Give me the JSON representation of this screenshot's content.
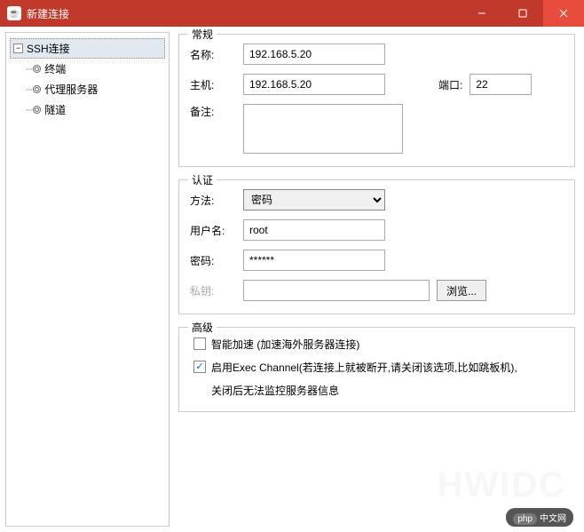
{
  "titlebar": {
    "title": "新建连接"
  },
  "sidebar": {
    "root": {
      "label": "SSH连接",
      "expanded": true
    },
    "children": [
      {
        "label": "终端"
      },
      {
        "label": "代理服务器"
      },
      {
        "label": "隧道"
      }
    ]
  },
  "general": {
    "legend": "常规",
    "name_label": "名称:",
    "name_value": "192.168.5.20",
    "host_label": "主机:",
    "host_value": "192.168.5.20",
    "port_label": "端口:",
    "port_value": "22",
    "remark_label": "备注:",
    "remark_value": ""
  },
  "auth": {
    "legend": "认证",
    "method_label": "方法:",
    "method_value": "密码",
    "user_label": "用户名:",
    "user_value": "root",
    "password_label": "密码:",
    "password_value": "******",
    "privkey_label": "私钥:",
    "privkey_value": "",
    "browse_label": "浏览..."
  },
  "advanced": {
    "legend": "高级",
    "accel_checked": false,
    "accel_label": "智能加速 (加速海外服务器连接)",
    "exec_checked": true,
    "exec_label": "启用Exec Channel(若连接上就被断开,请关闭该选项,比如跳板机),",
    "exec_note": "关闭后无法监控服务器信息"
  },
  "footer": {
    "php_label": "php",
    "php_suffix": "中文网"
  }
}
